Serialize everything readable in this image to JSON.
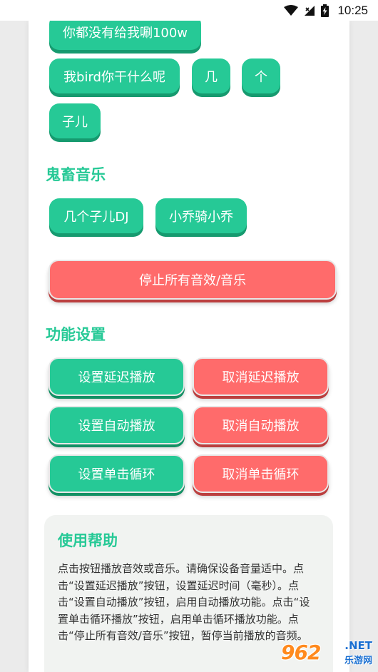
{
  "status_bar": {
    "time": "10:25"
  },
  "top_buttons": [
    {
      "label": "你都没有给我唰100w"
    },
    {
      "label": "我bird你干什么呢"
    },
    {
      "label": "几"
    },
    {
      "label": "个"
    },
    {
      "label": "子儿"
    }
  ],
  "ghost_music": {
    "title": "鬼畜音乐",
    "buttons": [
      {
        "label": "几个子儿DJ"
      },
      {
        "label": "小乔骑小乔"
      }
    ]
  },
  "stop_button": {
    "label": "停止所有音效/音乐"
  },
  "settings": {
    "title": "功能设置",
    "set_delay": "设置延迟播放",
    "cancel_delay": "取消延迟播放",
    "set_auto": "设置自动播放",
    "cancel_auto": "取消自动播放",
    "set_loop": "设置单击循环",
    "cancel_loop": "取消单击循环"
  },
  "help": {
    "title": "使用帮助",
    "text": "点击按钮播放音效或音乐。请确保设备音量适中。点击“设置延迟播放”按钮，设置延迟时间（毫秒）。点击“设置自动播放”按钮，启用自动播放功能。点击“设置单击循环播放”按钮，启用单击循环播放功能。点击“停止所有音效/音乐”按钮，暂停当前播放的音频。"
  },
  "watermark": {
    "logo": "962",
    "domain": ".NET",
    "sub": "乐游网"
  },
  "colors": {
    "accent_green": "#26c996",
    "accent_red": "#ff6b6b",
    "help_bg": "#f1f3f1"
  }
}
